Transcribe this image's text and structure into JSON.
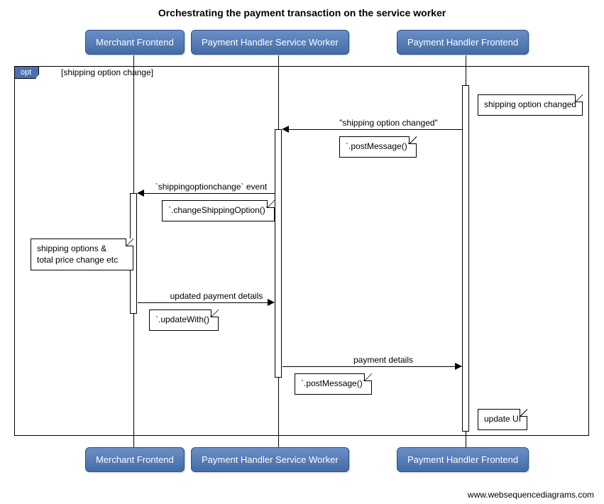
{
  "title": "Orchestrating the payment transaction on the service worker",
  "participants": {
    "p1": "Merchant Frontend",
    "p2": "Payment Handler Service Worker",
    "p3": "Payment Handler Frontend"
  },
  "opt": {
    "tag": "opt",
    "guard": "[shipping option change]"
  },
  "messages": {
    "m1_label": "\"shipping option changed\"",
    "m1_note": "`.postMessage()`",
    "m2_label": "`shippingoptionchange` event",
    "m2_note": "`.changeShippingOption()`",
    "m3_label": "updated payment details",
    "m3_note": "`.updateWith()`",
    "m4_label": "payment details",
    "m4_note": "`.postMessage()`"
  },
  "notes": {
    "n_changed": "shipping option changed",
    "n_totals": "shipping options &\ntotal price change etc",
    "n_update_ui": "update UI"
  },
  "attribution": "www.websequencediagrams.com",
  "chart_data": {
    "type": "sequence_diagram",
    "title": "Orchestrating the payment transaction on the service worker",
    "participants": [
      "Merchant Frontend",
      "Payment Handler Service Worker",
      "Payment Handler Frontend"
    ],
    "fragments": [
      {
        "type": "opt",
        "guard": "shipping option change",
        "steps": [
          {
            "type": "note",
            "over": "Payment Handler Frontend",
            "text": "shipping option changed"
          },
          {
            "type": "message",
            "from": "Payment Handler Frontend",
            "to": "Payment Handler Service Worker",
            "label": "\"shipping option changed\"",
            "mechanism": ".postMessage()"
          },
          {
            "type": "message",
            "from": "Payment Handler Service Worker",
            "to": "Merchant Frontend",
            "label": "`shippingoptionchange` event",
            "mechanism": ".changeShippingOption()"
          },
          {
            "type": "note",
            "over": "Merchant Frontend",
            "text": "shipping options & total price change etc"
          },
          {
            "type": "message",
            "from": "Merchant Frontend",
            "to": "Payment Handler Service Worker",
            "label": "updated payment details",
            "mechanism": ".updateWith()"
          },
          {
            "type": "message",
            "from": "Payment Handler Service Worker",
            "to": "Payment Handler Frontend",
            "label": "payment details",
            "mechanism": ".postMessage()"
          },
          {
            "type": "note",
            "over": "Payment Handler Frontend",
            "text": "update UI"
          }
        ]
      }
    ]
  }
}
